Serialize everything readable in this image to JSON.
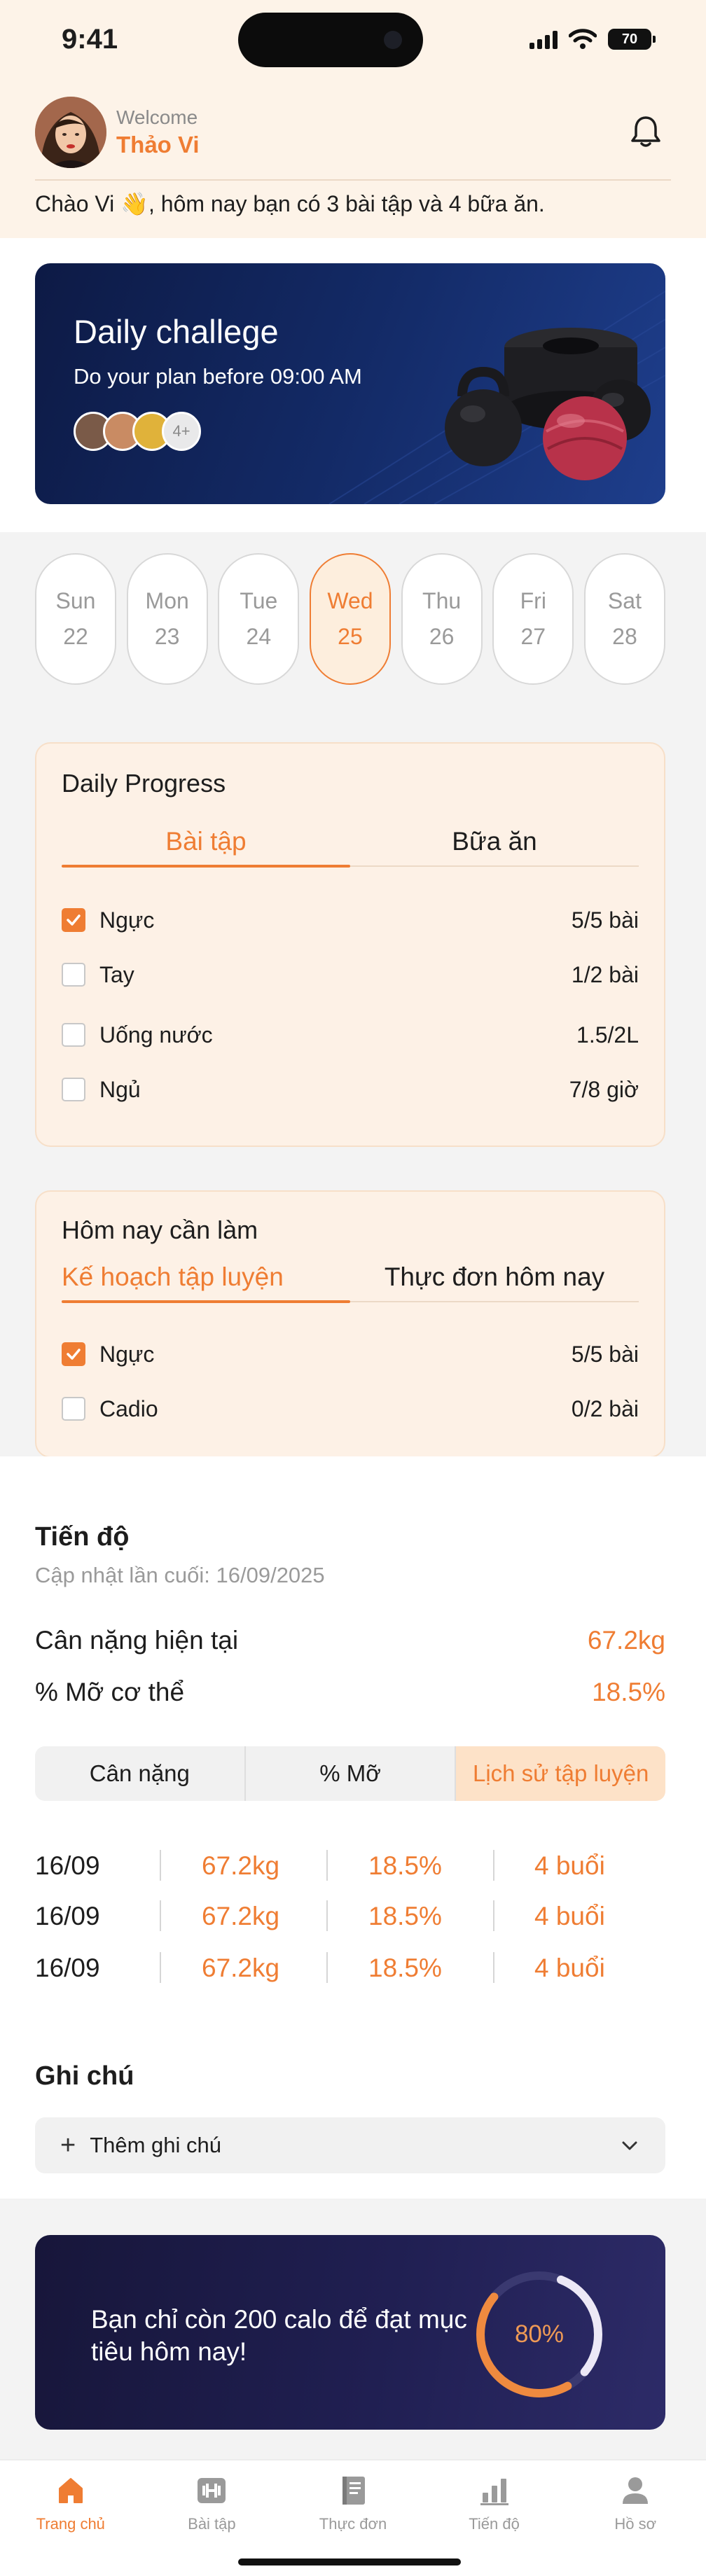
{
  "status_bar": {
    "time": "9:41",
    "battery": "70"
  },
  "header": {
    "welcome": "Welcome",
    "user_name": "Thảo Vi",
    "greeting": "Chào Vi 👋, hôm nay bạn có 3 bài tập và 4 bữa ăn."
  },
  "challenge": {
    "title": "Daily challege",
    "subtitle": "Do your plan before 09:00 AM",
    "more_count": "4+"
  },
  "days": [
    {
      "name": "Sun",
      "date": "22",
      "active": false
    },
    {
      "name": "Mon",
      "date": "23",
      "active": false
    },
    {
      "name": "Tue",
      "date": "24",
      "active": false
    },
    {
      "name": "Wed",
      "date": "25",
      "active": true
    },
    {
      "name": "Thu",
      "date": "26",
      "active": false
    },
    {
      "name": "Fri",
      "date": "27",
      "active": false
    },
    {
      "name": "Sat",
      "date": "28",
      "active": false
    }
  ],
  "daily_progress": {
    "title": "Daily Progress",
    "tabs": [
      "Bài tập",
      "Bữa ăn"
    ],
    "items": [
      {
        "label": "Ngực",
        "value": "5/5 bài",
        "checked": true
      },
      {
        "label": "Tay",
        "value": "1/2 bài",
        "checked": false
      },
      {
        "label": "Uống nước",
        "value": "1.5/2L",
        "checked": false
      },
      {
        "label": "Ngủ",
        "value": "7/8 giờ",
        "checked": false
      }
    ]
  },
  "today_tasks": {
    "title": "Hôm nay cần làm",
    "tabs": [
      "Kế hoạch tập luyện",
      "Thực đơn hôm nay"
    ],
    "items": [
      {
        "label": "Ngực",
        "value": "5/5 bài",
        "checked": true
      },
      {
        "label": "Cadio",
        "value": "0/2 bài",
        "checked": false
      }
    ]
  },
  "progress": {
    "title": "Tiến độ",
    "updated": "Cập nhật lần cuối: 16/09/2025",
    "metrics": [
      {
        "label": "Cân nặng hiện tại",
        "value": "67.2kg"
      },
      {
        "label": "% Mỡ cơ thể",
        "value": "18.5%"
      }
    ],
    "segments": [
      "Cân nặng",
      "% Mỡ",
      "Lịch sử tập luyện"
    ],
    "history": [
      {
        "date": "16/09",
        "weight": "67.2kg",
        "fat": "18.5%",
        "sessions": "4 buổi"
      },
      {
        "date": "16/09",
        "weight": "67.2kg",
        "fat": "18.5%",
        "sessions": "4 buổi"
      },
      {
        "date": "16/09",
        "weight": "67.2kg",
        "fat": "18.5%",
        "sessions": "4 buổi"
      }
    ]
  },
  "notes": {
    "title": "Ghi chú",
    "add_label": "Thêm ghi chú"
  },
  "calorie_banner": {
    "text": "Bạn chỉ còn 200 calo để đạt mục tiêu hôm nay!",
    "percent_label": "80%",
    "percent": 0.8
  },
  "nav": [
    {
      "label": "Trang chủ",
      "icon": "home-icon",
      "active": true
    },
    {
      "label": "Bài tập",
      "icon": "dumbbell-icon",
      "active": false
    },
    {
      "label": "Thực đơn",
      "icon": "book-icon",
      "active": false
    },
    {
      "label": "Tiến độ",
      "icon": "bar-chart-icon",
      "active": false
    },
    {
      "label": "Hồ sơ",
      "icon": "profile-icon",
      "active": false
    }
  ],
  "colors": {
    "accent": "#ef7d33",
    "panel_bg": "#fdf1e6",
    "header_bg": "#fdf3e8",
    "challenge_bg": "#132a66",
    "banner_bg": "#201f52"
  }
}
